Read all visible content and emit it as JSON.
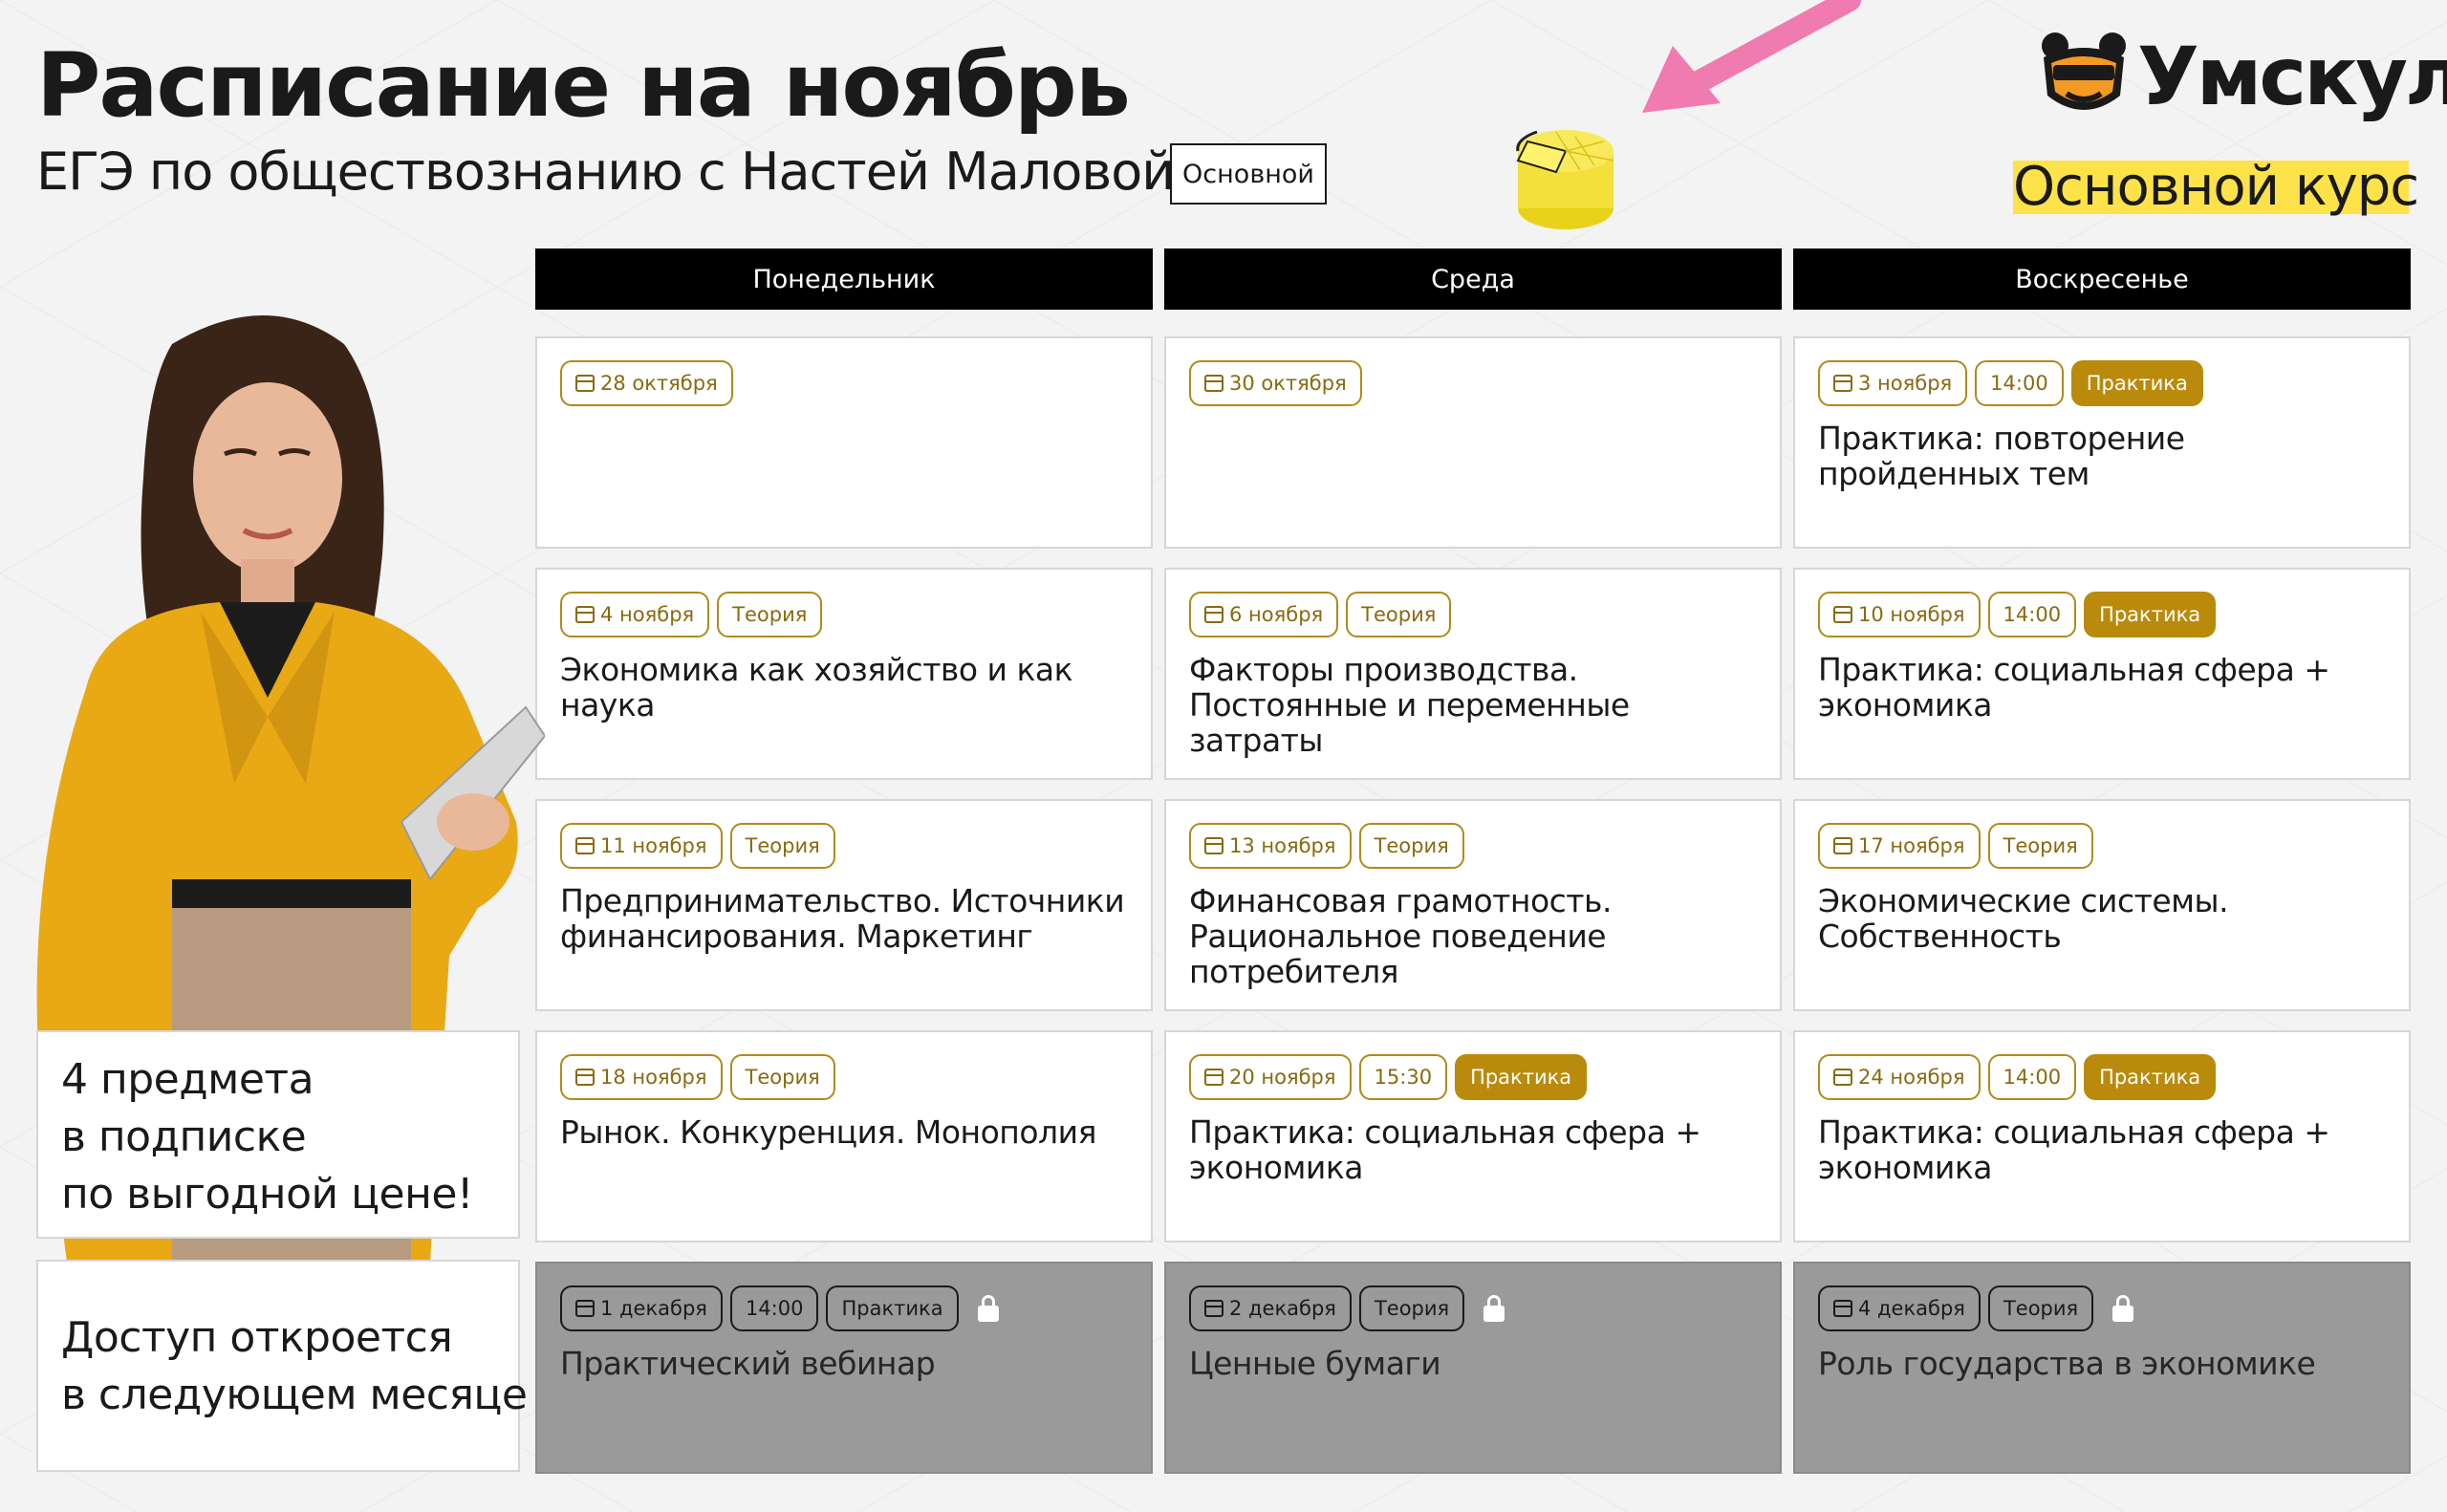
{
  "header": {
    "title": "Расписание на ноябрь",
    "subtitle": "ЕГЭ по обществознанию с Настей Маловой",
    "course_chip": "Основной"
  },
  "brand": {
    "name": "Умскул",
    "course": "Основной курс",
    "accent_color": "#fde24a"
  },
  "days": [
    "Понедельник",
    "Среда",
    "Воскресенье"
  ],
  "rows": [
    [
      {
        "date": "28 октября",
        "time": "",
        "type": "",
        "title": ""
      },
      {
        "date": "30 октября",
        "time": "",
        "type": "",
        "title": ""
      },
      {
        "date": "3 ноября",
        "time": "14:00",
        "type": "Практика",
        "title": "Практика: повторение пройденных тем"
      }
    ],
    [
      {
        "date": "4 ноября",
        "time": "",
        "type": "Теория",
        "title": "Экономика как хозяйство и как наука"
      },
      {
        "date": "6 ноября",
        "time": "",
        "type": "Теория",
        "title": "Факторы производства. Постоянные и переменные затраты"
      },
      {
        "date": "10 ноября",
        "time": "14:00",
        "type": "Практика",
        "title": "Практика: социальная сфера + экономика"
      }
    ],
    [
      {
        "date": "11 ноября",
        "time": "",
        "type": "Теория",
        "title": "Предпринимательство. Источники финансирования. Маркетинг"
      },
      {
        "date": "13 ноября",
        "time": "",
        "type": "Теория",
        "title": "Финансовая грамотность. Рациональное поведение потребителя"
      },
      {
        "date": "17 ноября",
        "time": "",
        "type": "Теория",
        "title": "Экономические системы. Собственность"
      }
    ],
    [
      {
        "date": "18 ноября",
        "time": "",
        "type": "Теория",
        "title": "Рынок. Конкуренция. Монополия"
      },
      {
        "date": "20 ноября",
        "time": "15:30",
        "type": "Практика",
        "title": "Практика: социальная сфера + экономика"
      },
      {
        "date": "24 ноября",
        "time": "14:00",
        "type": "Практика",
        "title": "Практика: социальная сфера + экономика"
      }
    ],
    [
      {
        "date": "1 декабря",
        "time": "14:00",
        "type": "Практика",
        "title": "Практический вебинар"
      },
      {
        "date": "2 декабря",
        "time": "",
        "type": "Теория",
        "title": "Ценные бумаги"
      },
      {
        "date": "4 декабря",
        "time": "",
        "type": "Теория",
        "title": "Роль государства в экономике"
      }
    ]
  ],
  "promo": {
    "line1": "4 предмета",
    "line2": "в подписке",
    "line3": "по выгодной цене!"
  },
  "access": {
    "line1": "Доступ откроется",
    "line2": "в следующем месяце"
  }
}
